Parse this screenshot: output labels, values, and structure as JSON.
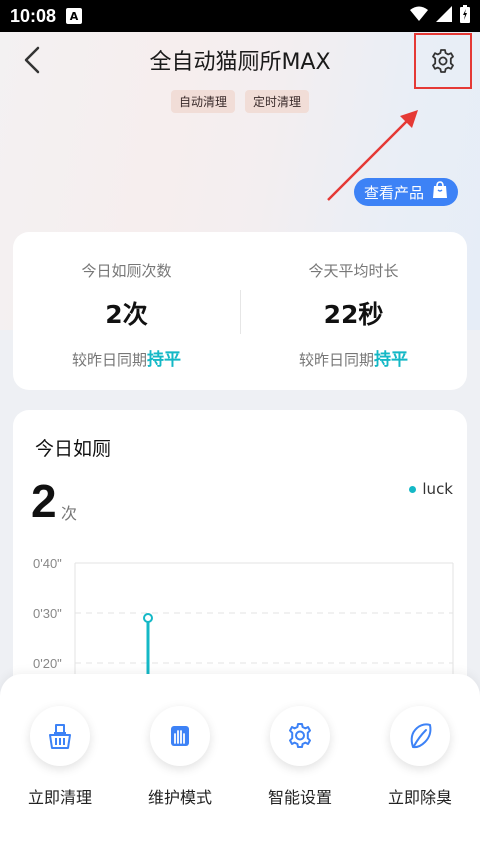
{
  "status_bar": {
    "time": "10:08",
    "notification_badge": "A"
  },
  "header": {
    "title": "全自动猫厕所MAX",
    "tags": [
      "自动清理",
      "定时清理"
    ],
    "view_product_label": "查看产品"
  },
  "stats": {
    "left": {
      "label": "今日如厕次数",
      "value": "2次",
      "compare_prefix": "较昨日同期",
      "compare_value": "持平"
    },
    "right": {
      "label": "今天平均时长",
      "value": "22秒",
      "compare_prefix": "较昨日同期",
      "compare_value": "持平"
    }
  },
  "chart_card": {
    "title": "今日如厕",
    "count": "2",
    "count_unit": "次",
    "legend_label": "luck"
  },
  "chart_data": {
    "type": "scatter",
    "y_tick_labels": [
      "0'40\"",
      "0'30\"",
      "0'20\""
    ],
    "ylim_seconds": [
      0,
      40
    ],
    "series": [
      {
        "name": "luck",
        "points_seconds": [
          29
        ]
      }
    ],
    "color": "#14b8c6"
  },
  "actions": [
    {
      "label": "立即清理",
      "icon": "basket-icon"
    },
    {
      "label": "维护模式",
      "icon": "hand-icon"
    },
    {
      "label": "智能设置",
      "icon": "smart-gear-icon"
    },
    {
      "label": "立即除臭",
      "icon": "leaf-icon"
    }
  ],
  "colors": {
    "accent": "#14b8c6",
    "primary": "#3d82f6",
    "highlight_box": "#e53935"
  }
}
